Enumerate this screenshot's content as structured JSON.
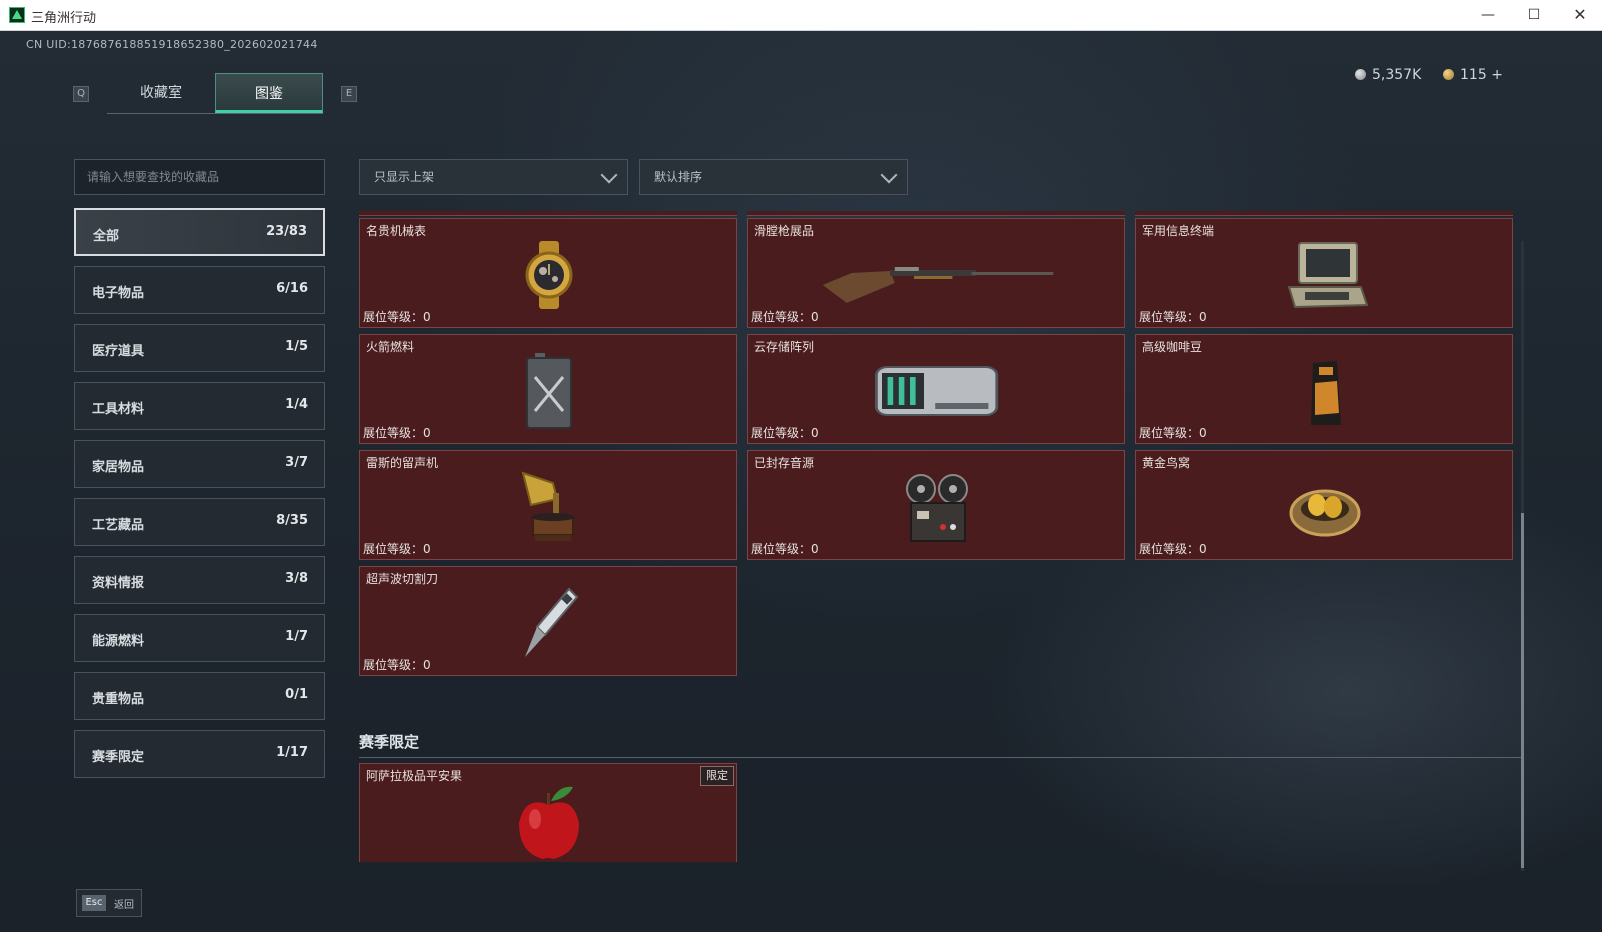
{
  "window": {
    "title": "三角洲行动",
    "min_glyph": "—",
    "max_glyph": "☐",
    "close_glyph": "✕"
  },
  "uid": "CN UID:187687618851918652380_202602021744",
  "nav": {
    "prev_key": "Q",
    "next_key": "E",
    "tabs": [
      {
        "label": "收藏室",
        "active": false
      },
      {
        "label": "图鉴",
        "active": true
      }
    ]
  },
  "currency": {
    "silver": "5,357K",
    "gold": "115",
    "add": "+"
  },
  "search": {
    "placeholder": "请输入想要查找的收藏品"
  },
  "filters": {
    "availability": "只显示上架",
    "sort": "默认排序"
  },
  "categories": [
    {
      "label": "全部",
      "count": "23/83",
      "active": true
    },
    {
      "label": "电子物品",
      "count": "6/16"
    },
    {
      "label": "医疗道具",
      "count": "1/5"
    },
    {
      "label": "工具材料",
      "count": "1/4"
    },
    {
      "label": "家居物品",
      "count": "3/7"
    },
    {
      "label": "工艺藏品",
      "count": "8/35"
    },
    {
      "label": "资料情报",
      "count": "3/8"
    },
    {
      "label": "能源燃料",
      "count": "1/7"
    },
    {
      "label": "贵重物品",
      "count": "0/1"
    },
    {
      "label": "赛季限定",
      "count": "1/17"
    }
  ],
  "items": [
    {
      "name": "名贵机械表",
      "level": "展位等级：0",
      "icon": "watch-icon"
    },
    {
      "name": "滑膛枪展品",
      "level": "展位等级：0",
      "icon": "musket-icon"
    },
    {
      "name": "军用信息终端",
      "level": "展位等级：0",
      "icon": "terminal-icon"
    },
    {
      "name": "火箭燃料",
      "level": "展位等级：0",
      "icon": "fuel-can-icon"
    },
    {
      "name": "云存储阵列",
      "level": "展位等级：0",
      "icon": "storage-array-icon"
    },
    {
      "name": "高级咖啡豆",
      "level": "展位等级：0",
      "icon": "coffee-bag-icon"
    },
    {
      "name": "雷斯的留声机",
      "level": "展位等级：0",
      "icon": "gramophone-icon"
    },
    {
      "name": "已封存音源",
      "level": "展位等级：0",
      "icon": "reel-recorder-icon"
    },
    {
      "name": "黄金鸟窝",
      "level": "展位等级：0",
      "icon": "golden-nest-icon"
    },
    {
      "name": "超声波切割刀",
      "level": "展位等级：0",
      "icon": "ultrasonic-knife-icon"
    }
  ],
  "season_section": {
    "title": "赛季限定",
    "items": [
      {
        "name": "阿萨拉极品平安果",
        "badge": "限定",
        "icon": "apple-icon"
      }
    ]
  },
  "footer": {
    "key": "Esc",
    "label": "返回"
  },
  "colors": {
    "card_bg": "#4a1c1e",
    "card_border": "#7a4446",
    "active_tab_accent": "#3fd0a8",
    "panel_bg": "#1a2129"
  }
}
